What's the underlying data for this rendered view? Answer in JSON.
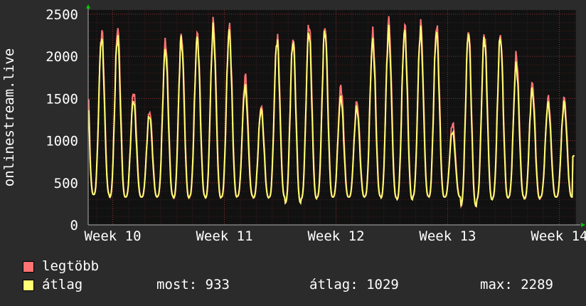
{
  "chart_data": {
    "type": "line",
    "ylabel": "onlinestream.live",
    "ylim": [
      0,
      2550
    ],
    "yticks": [
      0,
      500,
      1000,
      1500,
      2000,
      2500
    ],
    "ytick_labels": [
      "0",
      "500",
      "1000",
      "1500",
      "2000",
      "2500"
    ],
    "xlim": [
      9.78,
      14.15
    ],
    "xticks": [
      10,
      11,
      12,
      13,
      14
    ],
    "xtick_labels": [
      "Week 10",
      "Week 11",
      "Week 12",
      "Week 13",
      "Week 14"
    ],
    "grid": true,
    "day_peaks": {
      "series_legtobb": [
        2300,
        2340,
        1580,
        1350,
        2180,
        2250,
        2250,
        2390,
        2350,
        1760,
        1410,
        2230,
        2220,
        2390,
        2360,
        1640,
        1460,
        2270,
        2420,
        2350,
        2380,
        2370,
        1210,
        2320,
        2270,
        2260,
        2010,
        1680,
        1500
      ],
      "series_atlag": [
        2220,
        2230,
        1480,
        1300,
        2080,
        2200,
        2220,
        2310,
        2290,
        1640,
        1370,
        2190,
        2180,
        2300,
        2310,
        1520,
        1390,
        2180,
        2290,
        2300,
        2300,
        2290,
        1110,
        2280,
        2220,
        2230,
        1900,
        1590,
        1440
      ]
    },
    "day_troughs": [
      360,
      330,
      330,
      330,
      340,
      320,
      340,
      320,
      330,
      340,
      320,
      330,
      260,
      310,
      330,
      330,
      330,
      340,
      320,
      300,
      340,
      330,
      330,
      220,
      300,
      320,
      330,
      310,
      330
    ],
    "last_value": 933,
    "series": [
      {
        "name": "legtöbb",
        "color": "#ff7373"
      },
      {
        "name": "átlag",
        "color": "#ffff73"
      }
    ]
  },
  "legend": {
    "max_label": "legtöbb",
    "avg_label": "átlag"
  },
  "stats": {
    "current": "most: 933",
    "average": "átlag: 1029",
    "maximum": "max: 2289"
  },
  "colors": {
    "background": "#2b2b2b",
    "plot_bg": "#111111",
    "grid": "#6a2b2b",
    "axis": "#b0b0b0",
    "max_line": "#ff7373",
    "avg_line": "#ffff73",
    "arrow": "#00c800"
  }
}
